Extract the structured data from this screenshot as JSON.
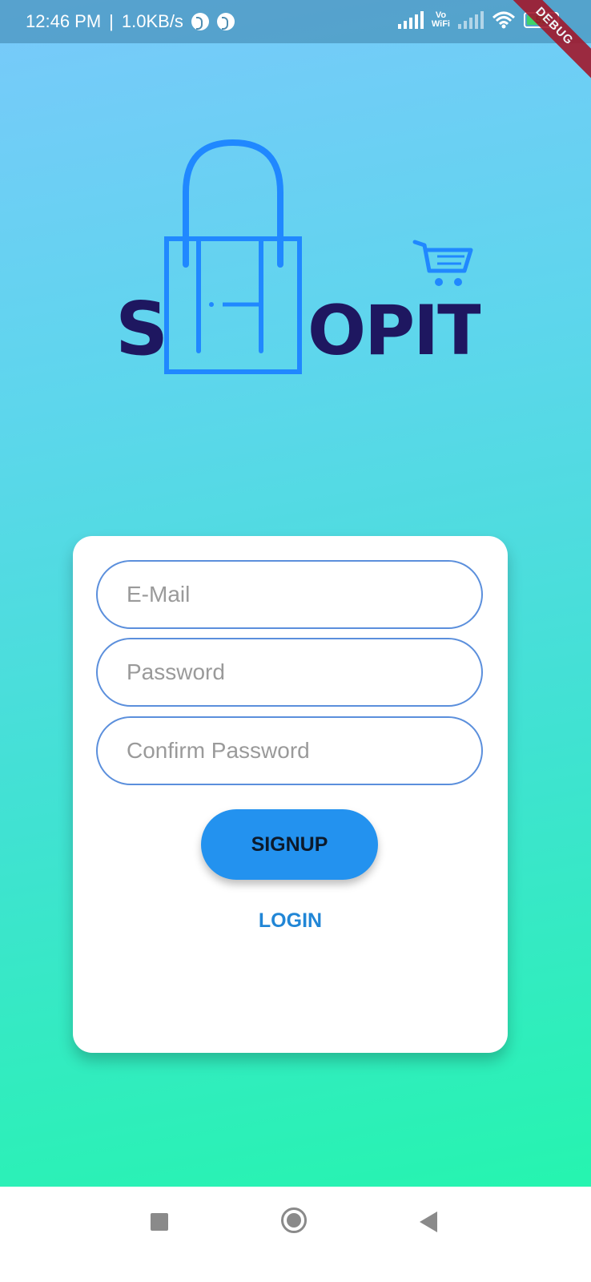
{
  "status_bar": {
    "time": "12:46 PM",
    "speed": "1.0KB/s",
    "separator": "|",
    "vowifi_top": "Vo",
    "vowifi_bottom": "WiFi",
    "battery_level": "59",
    "debug_label": "DEBUG"
  },
  "logo": {
    "brand_name": "SHOPIT",
    "icons": [
      "shopping-bag-icon",
      "shopping-cart-icon"
    ],
    "bag_color": "#2088ff",
    "text_color": "#1e1760"
  },
  "form": {
    "email_placeholder": "E-Mail",
    "email_value": "",
    "password_placeholder": "Password",
    "password_value": "",
    "confirm_password_placeholder": "Confirm Password",
    "confirm_password_value": "",
    "signup_label": "SIGNUP",
    "login_label": "LOGIN"
  },
  "colors": {
    "primary_button": "#2392ef",
    "link": "#2186d6",
    "field_border": "#5b8fdc"
  },
  "nav_bar": {
    "icons": [
      "recent-apps-icon",
      "home-icon",
      "back-icon"
    ]
  }
}
